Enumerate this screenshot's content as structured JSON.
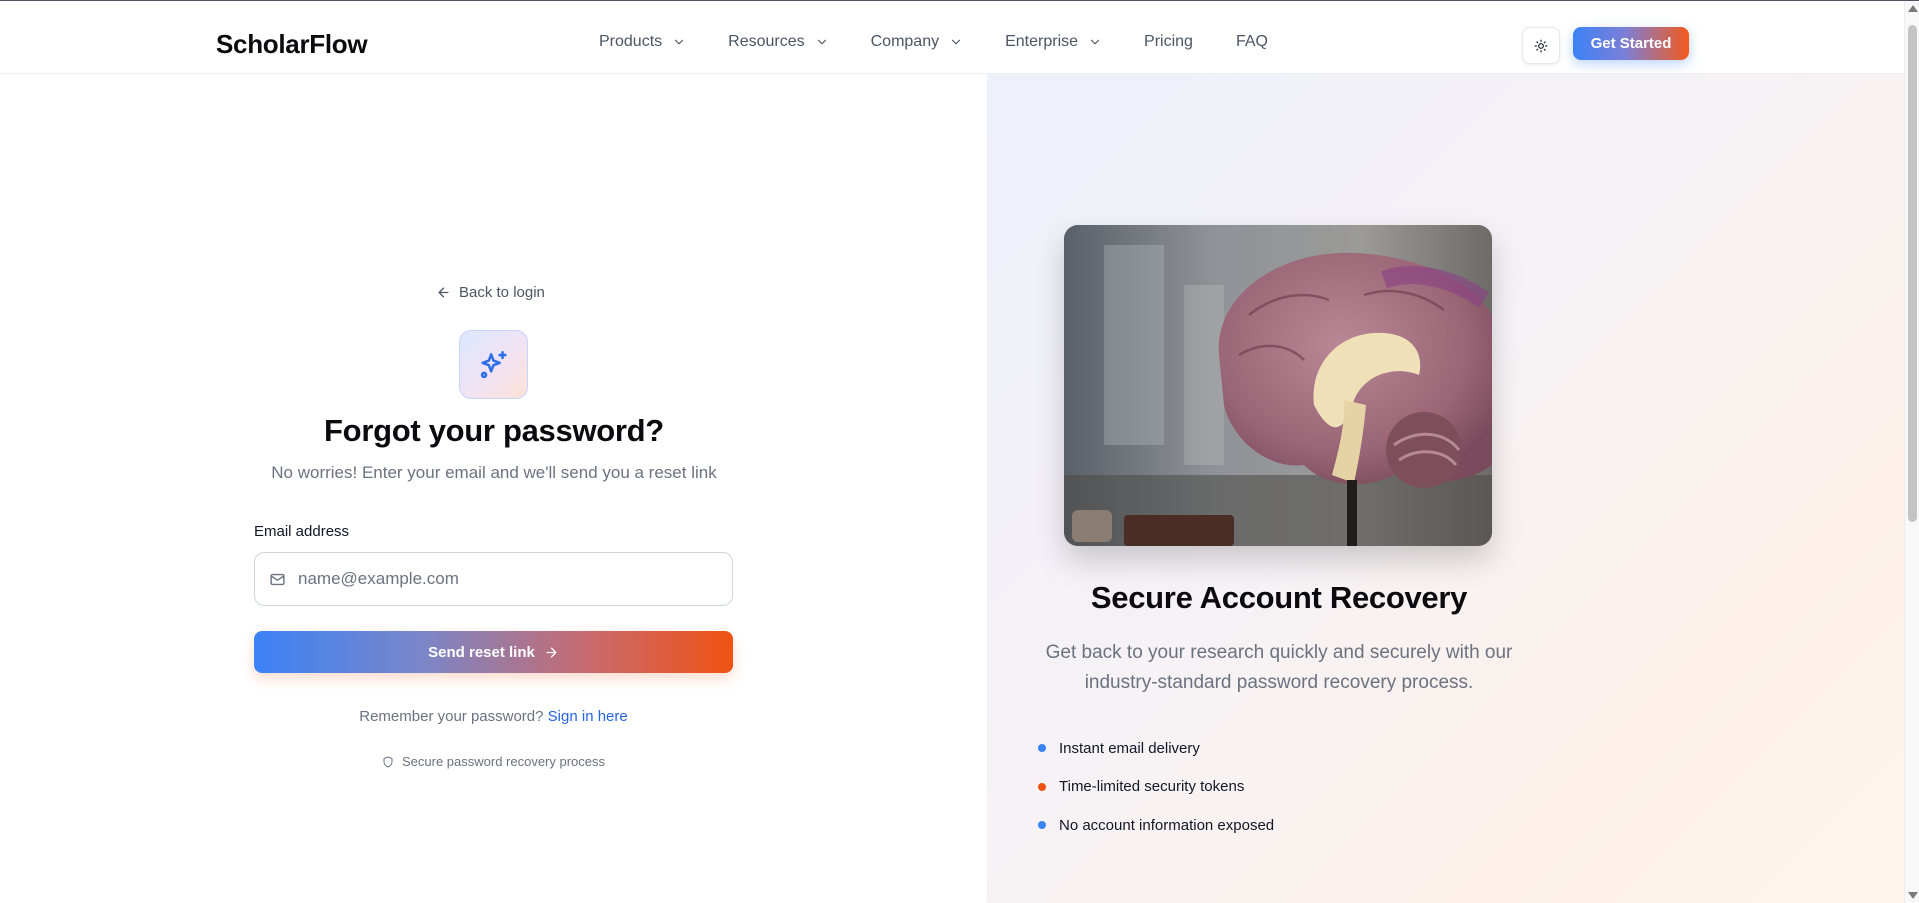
{
  "header": {
    "logo": "ScholarFlow",
    "nav": [
      {
        "label": "Products",
        "has_dropdown": true
      },
      {
        "label": "Resources",
        "has_dropdown": true
      },
      {
        "label": "Company",
        "has_dropdown": true
      },
      {
        "label": "Enterprise",
        "has_dropdown": true
      },
      {
        "label": "Pricing",
        "has_dropdown": false
      },
      {
        "label": "FAQ",
        "has_dropdown": false
      }
    ],
    "theme_icon": "sun-icon",
    "cta_label": "Get Started"
  },
  "form": {
    "back_label": "Back to login",
    "badge_icon": "sparkles-icon",
    "title": "Forgot your password?",
    "subtitle": "No worries! Enter your email and we'll send you a reset link",
    "email_label": "Email address",
    "email_value": "",
    "email_placeholder": "name@example.com",
    "submit_label": "Send reset link",
    "remember_text": "Remember your password?",
    "signin_link": "Sign in here",
    "secure_note": "Secure password recovery process"
  },
  "hero": {
    "image_alt": "brain-model-photo",
    "title": "Secure Account Recovery",
    "description": "Get back to your research quickly and securely with our industry-standard password recovery process.",
    "features": [
      {
        "label": "Instant email delivery",
        "dot_color": "#3b82f6"
      },
      {
        "label": "Time-limited security tokens",
        "dot_color": "#f05212"
      },
      {
        "label": "No account information exposed",
        "dot_color": "#3b82f6"
      }
    ]
  },
  "colors": {
    "accent_blue": "#3b82f6",
    "accent_orange": "#f05212",
    "link_blue": "#2563eb"
  }
}
